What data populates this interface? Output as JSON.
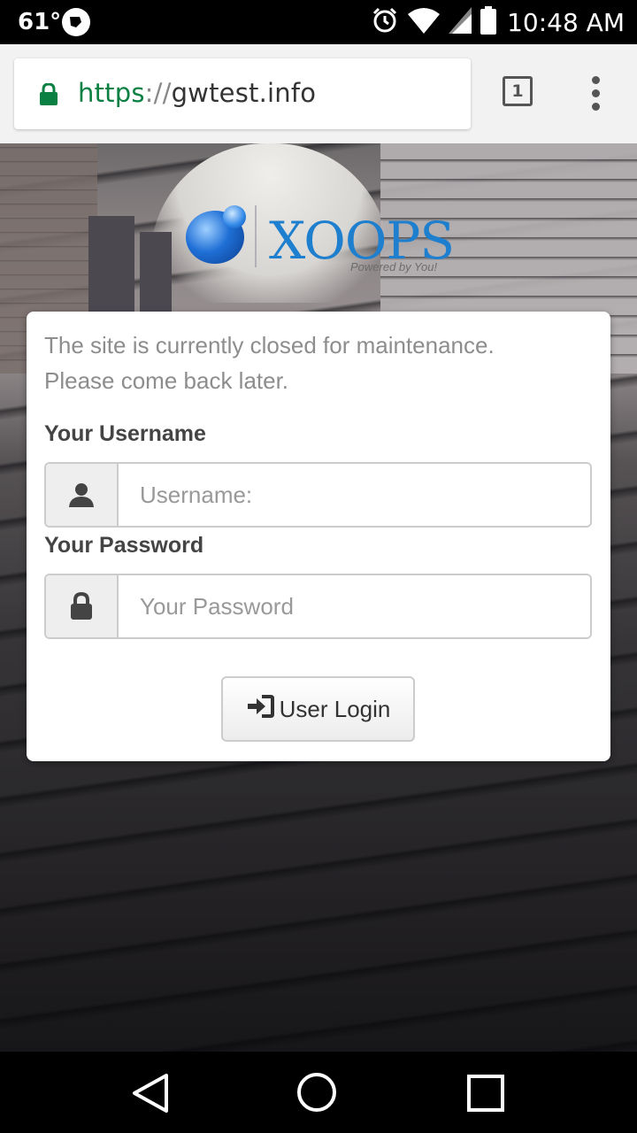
{
  "status_bar": {
    "temperature": "61°",
    "time": "10:48 AM",
    "icons": [
      "alarm-icon",
      "wifi-icon",
      "signal-icon",
      "battery-icon"
    ]
  },
  "browser": {
    "url_scheme": "https",
    "url_separator": "://",
    "url_host": "gwtest.info",
    "tab_count": "1",
    "secure_color": "#0b8043"
  },
  "logo": {
    "text": "XOOPS",
    "subtitle": "Powered by You!"
  },
  "login": {
    "notice_line1": "The site is currently closed for maintenance.",
    "notice_line2": "Please come back later.",
    "username_label": "Your Username",
    "username_placeholder": "Username:",
    "password_label": "Your Password",
    "password_placeholder": "Your Password",
    "login_button": "User Login"
  }
}
